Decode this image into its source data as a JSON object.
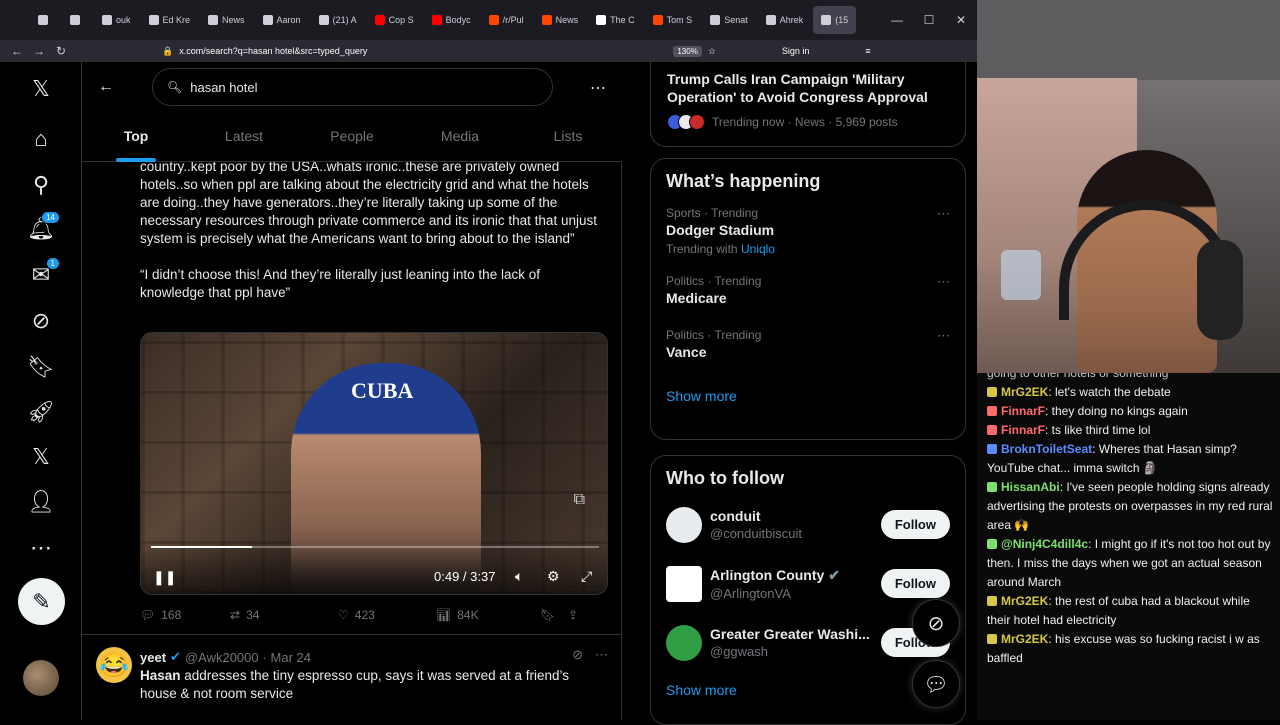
{
  "browser": {
    "tabs": [
      {
        "label": "",
        "color": "#cfcfd8"
      },
      {
        "label": "",
        "color": "#cfcfd8"
      },
      {
        "label": "ouk",
        "color": "#cfcfd8"
      },
      {
        "label": "Ed Kre",
        "color": "#cfcfd8"
      },
      {
        "label": "News",
        "color": "#cfcfd8"
      },
      {
        "label": "Aaron",
        "color": "#cfcfd8"
      },
      {
        "label": "(21) A",
        "color": "#cfcfd8"
      },
      {
        "label": "Cop S",
        "color": "#ff0000"
      },
      {
        "label": "Bodyc",
        "color": "#ff0000"
      },
      {
        "label": "/r/Pul",
        "color": "#ff4500"
      },
      {
        "label": "News",
        "color": "#ff4500"
      },
      {
        "label": "The C",
        "color": "#ffffff"
      },
      {
        "label": "Tom S",
        "color": "#ff4500"
      },
      {
        "label": "Senat",
        "color": "#cfcfd8"
      },
      {
        "label": "Ahrek",
        "color": "#cfcfd8"
      },
      {
        "label": "(15",
        "color": "#cfcfd8"
      }
    ],
    "url": "x.com/search?q=hasan hotel&src=typed_query",
    "zoom": "130%",
    "signin": "Sign in"
  },
  "nav": {
    "notifications_badge": "14",
    "messages_badge": "1"
  },
  "search": {
    "query": "hasan hotel",
    "tabs": [
      "Top",
      "Latest",
      "People",
      "Media",
      "Lists"
    ]
  },
  "tweet1": {
    "text1": "country..kept poor by the USA..whats ironic..these are privately owned hotels..so when ppl are talking about the electricity grid and what the hotels are doing..they have generators..they’re literally taking up some of the necessary resources through private commerce and its ironic that that unjust system is precisely what the Americans want to bring about to the island”",
    "text2": "“I didn’t choose this! And they’re literally just leaning into the lack of knowledge that ppl have”",
    "video": {
      "time": "0:49 / 3:37",
      "progress": 0.225,
      "overlay_text": "CUBA"
    },
    "replies": "168",
    "reposts": "34",
    "likes": "423",
    "views": "84K"
  },
  "tweet2": {
    "name": "yeet",
    "handle": "@Awk20000",
    "date": "· Mar 24",
    "text_bold": "Hasan",
    "text": " addresses the tiny espresso cup, says it was served at a friend’s house & not room service"
  },
  "right": {
    "top_trend": {
      "headline": "Trump Calls Iran Campaign 'Military Operation' to Avoid Congress Approval",
      "meta": "Trending now · News · 5,969 posts"
    },
    "whats_happening": {
      "title": "What’s happening",
      "trends": [
        {
          "cat": "Sports · Trending",
          "name": "Dodger Stadium",
          "with_label": "Trending with",
          "with_link": "Uniqlo"
        },
        {
          "cat": "Politics · Trending",
          "name": "Medicare"
        },
        {
          "cat": "Politics · Trending",
          "name": "Vance"
        }
      ],
      "show_more": "Show more"
    },
    "who_to_follow": {
      "title": "Who to follow",
      "accounts": [
        {
          "name": "conduit",
          "handle": "@conduitbiscuit",
          "follow": "Follow"
        },
        {
          "name": "Arlington County",
          "handle": "@ArlingtonVA",
          "follow": "Follow"
        },
        {
          "name": "Greater Greater Washi...",
          "handle": "@ggwash",
          "follow": "Follow"
        }
      ],
      "show_more": "Show more"
    }
  },
  "chat": {
    "first": "going to other hotels or something",
    "messages": [
      {
        "user": "MrG2EK",
        "color": "#d6c74a",
        "text": ": let's watch the debate"
      },
      {
        "user": "FinnarF",
        "color": "#ff6b6b",
        "text": ": they doing no kings again"
      },
      {
        "user": "FinnarF",
        "color": "#ff6b6b",
        "text": ": ts like third time lol"
      },
      {
        "user": "BroknToiletSeat",
        "color": "#5b8cff",
        "text": ": Wheres that Hasan simp? YouTube chat... imma switch 🗿"
      },
      {
        "user": "HissanAbi",
        "color": "#7ee06e",
        "text": ": I've seen people holding signs already advertising the protests on overpasses in my red rural area 🙌"
      },
      {
        "user": "@Ninj4C4dill4c",
        "color": "#7ee06e",
        "text": ": I might go if it's not too hot out by then. I miss the days when we got an actual season around March"
      },
      {
        "user": "MrG2EK",
        "color": "#d6c74a",
        "text": ": the rest of cuba had a blackout while their hotel had electricity"
      },
      {
        "user": "MrG2EK",
        "color": "#d6c74a",
        "text": ": his excuse was so fucking racist i w as baffled"
      }
    ]
  }
}
